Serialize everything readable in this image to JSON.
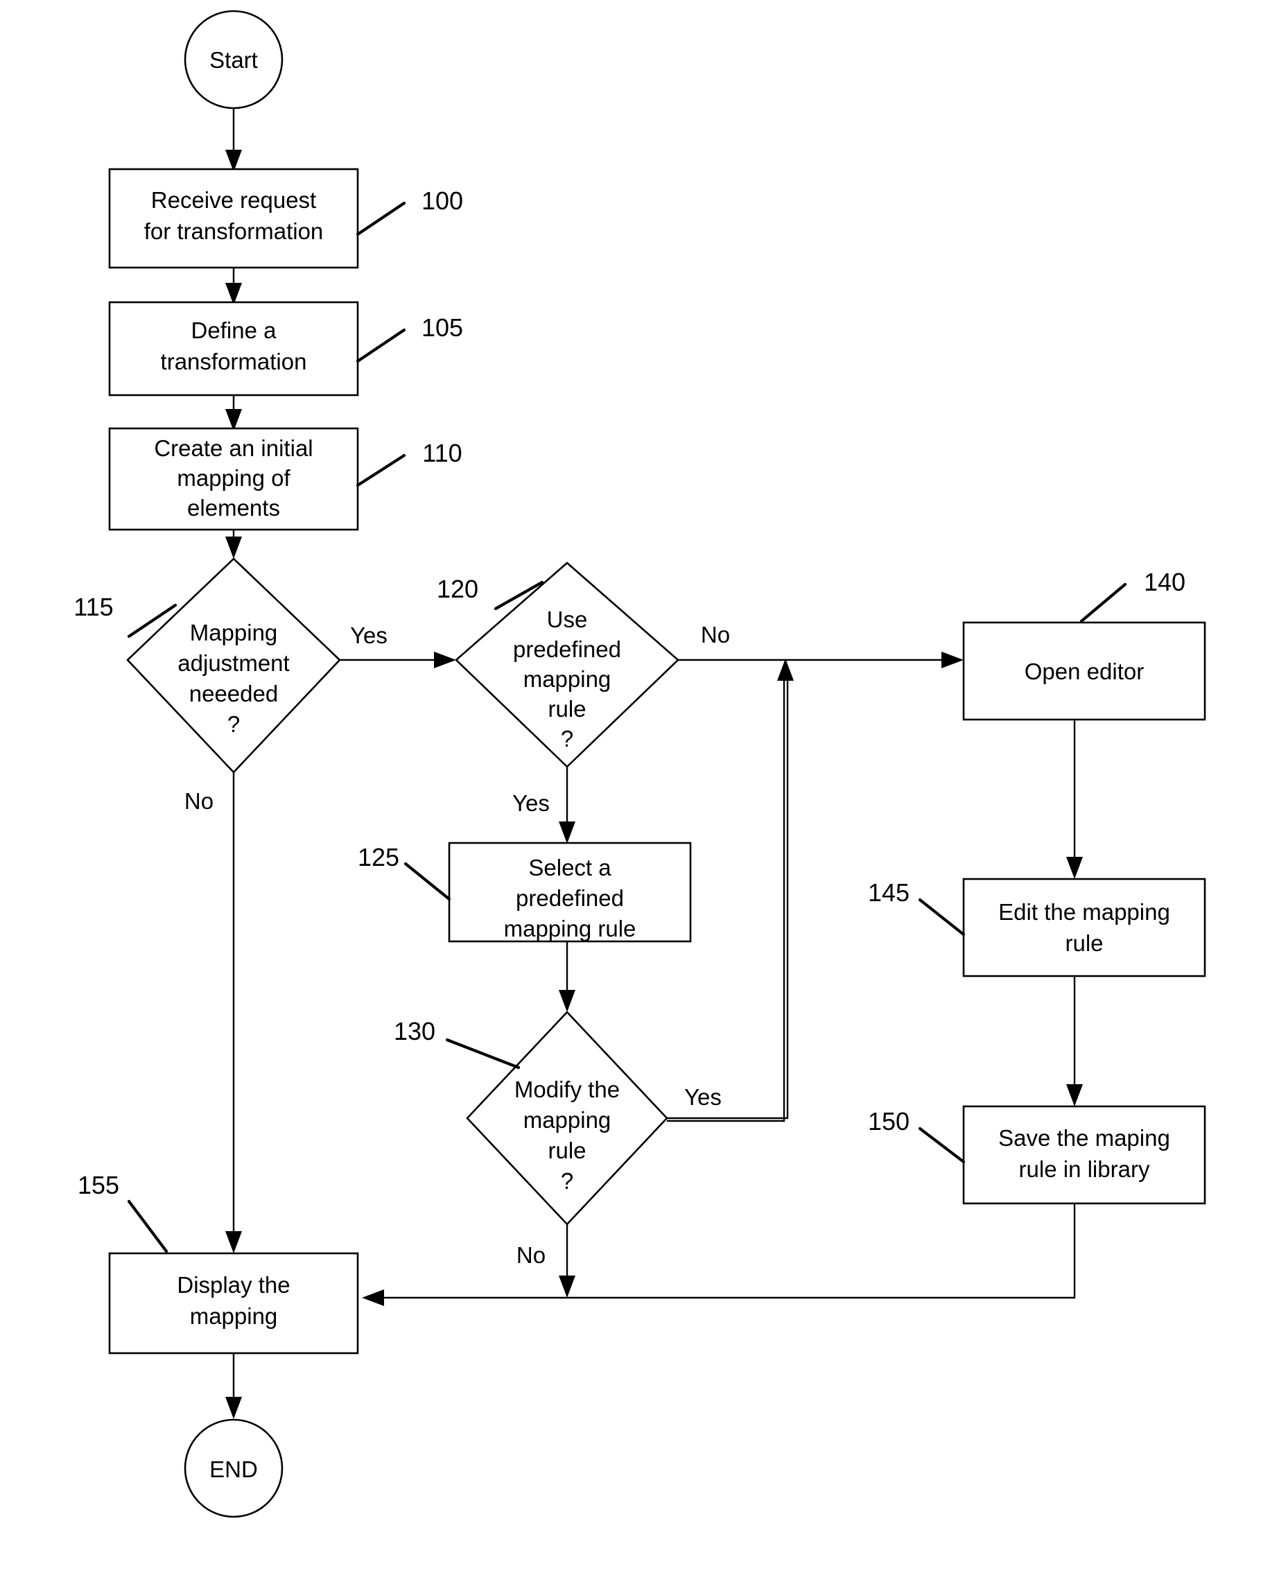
{
  "diagram": {
    "type": "flowchart",
    "title": "Mapping transformation process flowchart",
    "background_color": "#ffffff",
    "line_color": "#000000",
    "nodes": [
      {
        "id": "start",
        "shape": "terminator-circle",
        "label": "Start",
        "lines": [
          "Start"
        ]
      },
      {
        "id": "n100",
        "shape": "process",
        "ref": "100",
        "lines": [
          "Receive request",
          "for transformation"
        ]
      },
      {
        "id": "n105",
        "shape": "process",
        "ref": "105",
        "lines": [
          "Define a",
          "transformation"
        ]
      },
      {
        "id": "n110",
        "shape": "process",
        "ref": "110",
        "lines": [
          "Create an initial",
          "mapping of",
          "elements"
        ]
      },
      {
        "id": "n115",
        "shape": "decision",
        "ref": "115",
        "lines": [
          "Mapping",
          "adjustment",
          "neeeded",
          "?"
        ]
      },
      {
        "id": "n120",
        "shape": "decision",
        "ref": "120",
        "lines": [
          "Use",
          "predefined",
          "mapping",
          "rule",
          "?"
        ]
      },
      {
        "id": "n125",
        "shape": "process",
        "ref": "125",
        "lines": [
          "Select a",
          "predefined",
          "mapping rule"
        ]
      },
      {
        "id": "n130",
        "shape": "decision",
        "ref": "130",
        "lines": [
          "Modify the",
          "mapping",
          "rule",
          "?"
        ]
      },
      {
        "id": "n140",
        "shape": "process",
        "ref": "140",
        "lines": [
          "Open editor"
        ]
      },
      {
        "id": "n145",
        "shape": "process",
        "ref": "145",
        "lines": [
          "Edit the mapping",
          "rule"
        ]
      },
      {
        "id": "n150",
        "shape": "process",
        "ref": "150",
        "lines": [
          "Save the maping",
          "rule in library"
        ]
      },
      {
        "id": "n155",
        "shape": "process",
        "ref": "155",
        "lines": [
          "Display the",
          "mapping"
        ]
      },
      {
        "id": "end",
        "shape": "terminator-circle",
        "label": "END",
        "lines": [
          "END"
        ]
      }
    ],
    "edge_labels": {
      "yes_115": "Yes",
      "no_115": "No",
      "no_120": "No",
      "yes_120": "Yes",
      "yes_130": "Yes",
      "no_130": "No"
    },
    "ref_numbers": {
      "r100": "100",
      "r105": "105",
      "r110": "110",
      "r115": "115",
      "r120": "120",
      "r125": "125",
      "r130": "130",
      "r140": "140",
      "r145": "145",
      "r150": "150",
      "r155": "155"
    },
    "edges": [
      {
        "from": "start",
        "to": "n100",
        "label": ""
      },
      {
        "from": "n100",
        "to": "n105",
        "label": ""
      },
      {
        "from": "n105",
        "to": "n110",
        "label": ""
      },
      {
        "from": "n110",
        "to": "n115",
        "label": ""
      },
      {
        "from": "n115",
        "to": "n120",
        "label": "Yes"
      },
      {
        "from": "n115",
        "to": "n155",
        "label": "No"
      },
      {
        "from": "n120",
        "to": "n140",
        "label": "No"
      },
      {
        "from": "n120",
        "to": "n125",
        "label": "Yes"
      },
      {
        "from": "n125",
        "to": "n130",
        "label": ""
      },
      {
        "from": "n130",
        "to": "n140",
        "label": "Yes"
      },
      {
        "from": "n130",
        "to": "n155",
        "label": "No"
      },
      {
        "from": "n140",
        "to": "n145",
        "label": ""
      },
      {
        "from": "n145",
        "to": "n150",
        "label": ""
      },
      {
        "from": "n150",
        "to": "n155",
        "label": ""
      },
      {
        "from": "n155",
        "to": "end",
        "label": ""
      }
    ]
  }
}
